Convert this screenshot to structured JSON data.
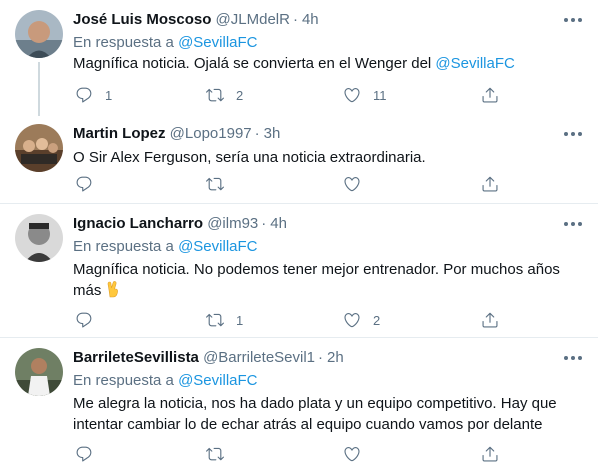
{
  "tweets": [
    {
      "name": "José Luis Moscoso",
      "handle": "@JLMdelR",
      "time": "4h",
      "reply_prefix": "En respuesta a",
      "reply_to": "@SevillaFC",
      "text": "Magnífica noticia. Ojalá se convierta en el Wenger del",
      "text_mention": "@SevillaFC",
      "replies": "1",
      "retweets": "2",
      "likes": "11"
    },
    {
      "name": "Martin Lopez",
      "handle": "@Lopo1997",
      "time": "3h",
      "text": "O Sir Alex Ferguson, sería una noticia extraordinaria."
    },
    {
      "name": "Ignacio Lancharro",
      "handle": "@ilm93",
      "time": "4h",
      "reply_prefix": "En respuesta a",
      "reply_to": "@SevillaFC",
      "text_line1": "Magnífica noticia. No podemos tener mejor entrenador. Por muchos años",
      "text_line2": "más",
      "retweets": "1",
      "likes": "2"
    },
    {
      "name": "BarrileteSevillista",
      "handle": "@BarrileteSevil1",
      "time": "2h",
      "reply_prefix": "En respuesta a",
      "reply_to": "@SevillaFC",
      "text_line1": "Me alegra la noticia, nos ha dado plata y un equipo competitivo. Hay que",
      "text_line2": "intentar cambiar lo de echar atrás al equipo cuando vamos por delante"
    }
  ],
  "dot": "·",
  "icons": {
    "reply": "reply-icon",
    "retweet": "retweet-icon",
    "like": "heart-icon",
    "share": "share-icon",
    "more": "more-icon",
    "emoji": "fingers-crossed-emoji"
  },
  "colors": {
    "text": "#0f1419",
    "muted": "#5b7083",
    "link": "#1b95e0",
    "divider": "#e6ecf0"
  }
}
